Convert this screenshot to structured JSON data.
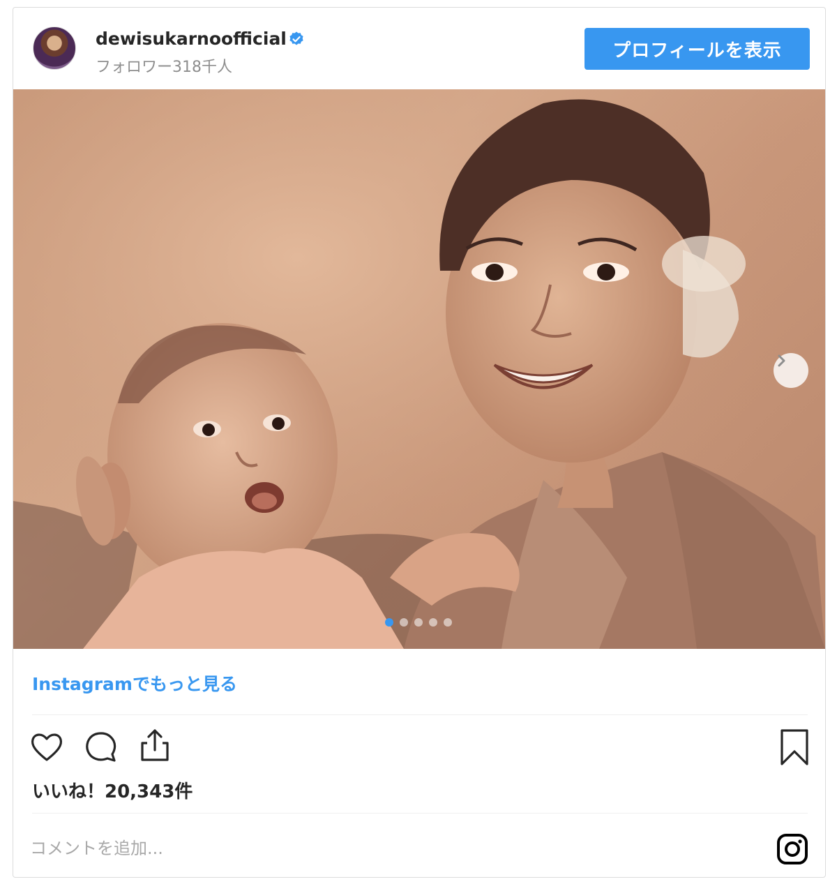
{
  "header": {
    "username": "dewisukarnoofficial",
    "followers": "フォロワー318千人",
    "profile_button": "プロフィールを表示"
  },
  "post": {
    "carousel_total": 5,
    "carousel_active": 1,
    "more_link": "Instagramでもっと見る",
    "likes": "いいね！20,343件"
  },
  "comment": {
    "placeholder": "コメントを追加..."
  },
  "icons": {
    "verified": "verified-badge-icon",
    "next": "chevron-right-icon",
    "like": "heart-icon",
    "comment": "comment-bubble-icon",
    "share": "share-icon",
    "save": "bookmark-icon",
    "instagram": "instagram-logo-icon"
  },
  "colors": {
    "accent": "#3897f0",
    "text": "#262626",
    "secondary": "#8e8e8e",
    "border": "#dbdbdb"
  }
}
